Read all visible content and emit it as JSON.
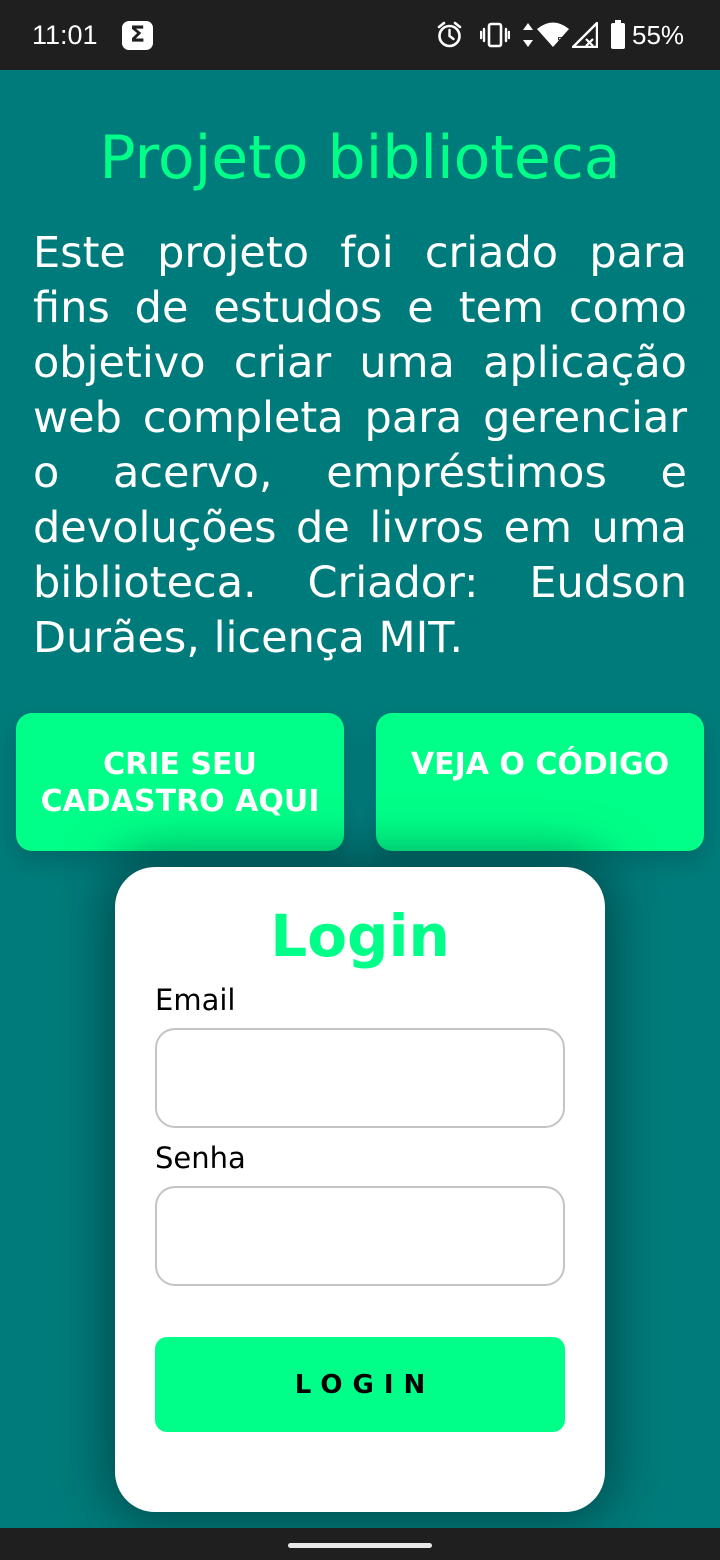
{
  "status_bar": {
    "time": "11:01",
    "app_icon": "sigma-icon",
    "app_icon_glyph": "Σ",
    "battery_percent": "55%",
    "icons": [
      "alarm-icon",
      "vibrate-icon",
      "wifi-icon",
      "signal-icon",
      "battery-icon"
    ]
  },
  "header": {
    "title": "Projeto biblioteca",
    "description": "Este projeto foi criado para fins de estudos e tem como objetivo criar uma aplicação web completa para gerenciar o acervo, empréstimos e devoluções de livros em uma biblioteca. Criador: Eudson Durães, licença MIT."
  },
  "actions": {
    "register_line1": "CRIE SEU",
    "register_line2": "CADASTRO AQUI",
    "code_label": "VEJA O CÓDIGO"
  },
  "login": {
    "title": "Login",
    "email_label": "Email",
    "email_value": "",
    "password_label": "Senha",
    "password_value": "",
    "button_label": "LOGIN"
  },
  "colors": {
    "background": "#007b7b",
    "accent": "#00ff88",
    "status_bar": "#1f1f1f",
    "card": "#ffffff"
  }
}
